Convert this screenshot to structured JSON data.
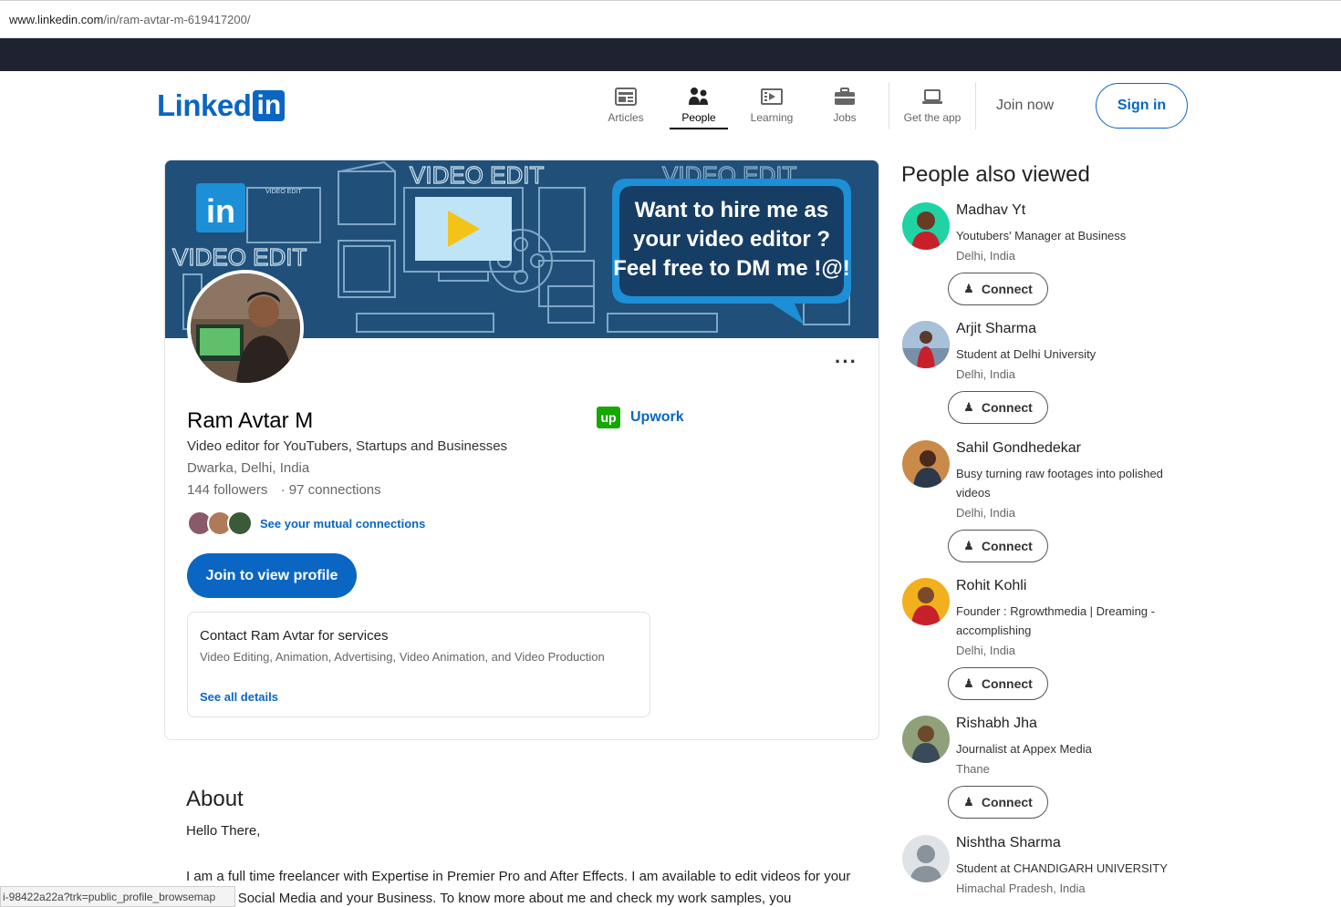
{
  "browser": {
    "url_host": "www.linkedin.com",
    "url_path": "/in/ram-avtar-m-619417200/",
    "status_url": "i-98422a22a?trk=public_profile_browsemap"
  },
  "header": {
    "logo_word": "Linked",
    "logo_box": "in",
    "nav": [
      {
        "label": "Articles",
        "icon": "articles-icon"
      },
      {
        "label": "People",
        "icon": "people-icon"
      },
      {
        "label": "Learning",
        "icon": "learning-icon"
      },
      {
        "label": "Jobs",
        "icon": "jobs-icon"
      },
      {
        "label": "Get the app",
        "icon": "laptop-icon"
      }
    ],
    "join_now": "Join now",
    "sign_in": "Sign in"
  },
  "banner": {
    "line1": "Want to hire me as",
    "line2": "your video editor ?",
    "line3": "Feel free to DM me !@!",
    "tag1": "VIDEO EDIT",
    "tag2": "VIDEO EDIT",
    "tag3": "VIDEO EDIT",
    "tag4": "VIDEO EDIT"
  },
  "profile": {
    "name": "Ram Avtar M",
    "headline": "Video editor for YouTubers, Startups and Businesses",
    "location": "Dwarka, Delhi, India",
    "followers": "144 followers",
    "connections": "· 97 connections",
    "mutual_link": "See your mutual connections",
    "company_logo": "up",
    "company": "Upwork",
    "join_button": "Join to view profile",
    "more": "···",
    "services": {
      "title": "Contact Ram Avtar for services",
      "list": "Video Editing, Animation, Advertising, Video Animation, and Video Production",
      "see_all": "See all details"
    }
  },
  "about": {
    "heading": "About",
    "p1": "Hello There,",
    "p2": "I am a full time freelancer with Expertise in Premier Pro and After Effects. I am available to edit videos for your growing Social Media and your Business. To know more about me and check my work samples, you"
  },
  "sidebar": {
    "heading": "People also viewed",
    "connect_label": "Connect",
    "people": [
      {
        "name": "Madhav Yt",
        "headline": "Youtubers' Manager at Business",
        "location": "Delhi, India",
        "color": "#1fd3a4"
      },
      {
        "name": "Arjit Sharma",
        "headline": "Student at Delhi University",
        "location": "Delhi, India",
        "color": "#7a8fa8"
      },
      {
        "name": "Sahil Gondhedekar",
        "headline": "Busy turning raw footages into polished videos",
        "location": "Delhi, India",
        "color": "#c98a4a"
      },
      {
        "name": "Rohit Kohli",
        "headline": "Founder : Rgrowthmedia | Dreaming - accomplishing",
        "location": "Delhi, India",
        "color": "#f2b01e"
      },
      {
        "name": "Rishabh Jha",
        "headline": "Journalist at Appex Media",
        "location": "Thane",
        "color": "#8fa07a"
      },
      {
        "name": "Nishtha Sharma",
        "headline": "Student at CHANDIGARH UNIVERSITY",
        "location": "Himachal Pradesh, India",
        "color": "#c9ced4"
      }
    ]
  },
  "colors": {
    "brand": "#0a66c2",
    "banner_bg": "#20507a",
    "upwork": "#14a800"
  }
}
